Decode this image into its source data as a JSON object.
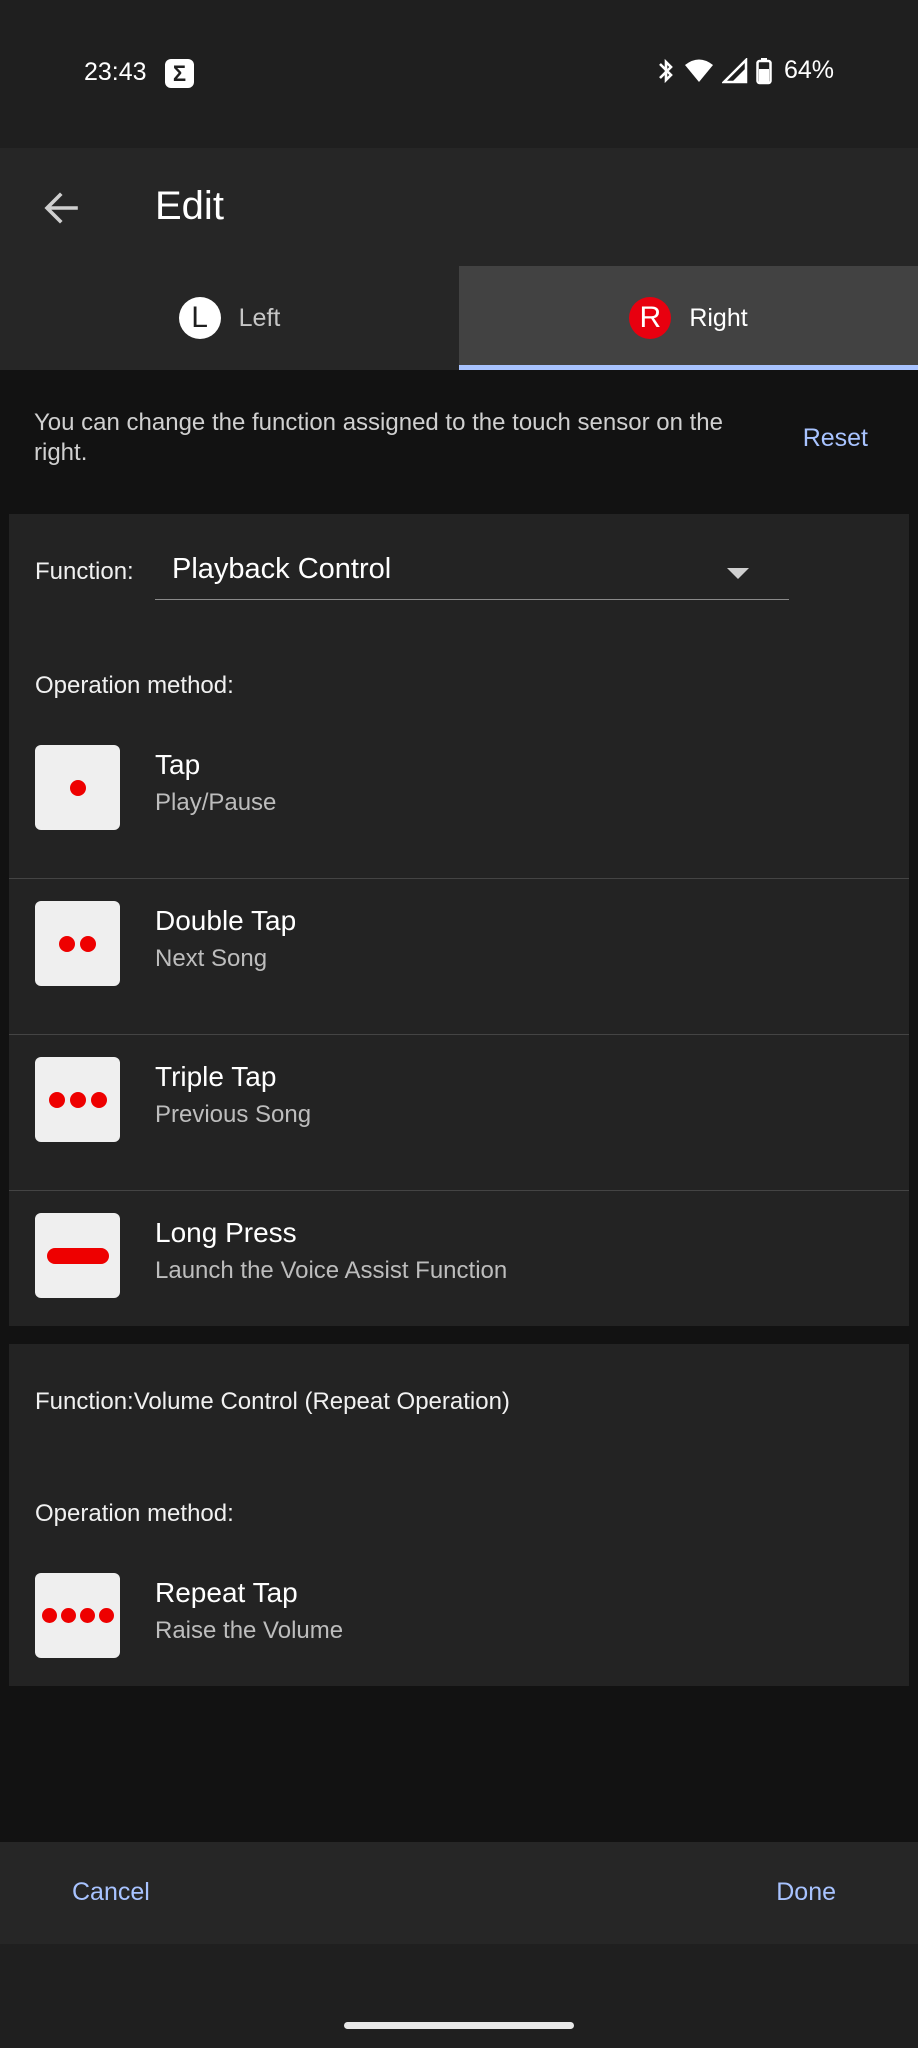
{
  "status_bar": {
    "time": "23:43",
    "battery": "64%"
  },
  "header": {
    "title": "Edit"
  },
  "tabs": [
    {
      "badge": "L",
      "label": "Left",
      "active": false
    },
    {
      "badge": "R",
      "label": "Right",
      "active": true
    }
  ],
  "description": {
    "text": "You can change the function assigned to the touch sensor on the right.",
    "reset_label": "Reset"
  },
  "card1": {
    "function_label": "Function:",
    "function_value": "Playback Control",
    "operation_heading": "Operation method:",
    "operations": [
      {
        "title": "Tap",
        "subtitle": "Play/Pause",
        "icon": "single-dot"
      },
      {
        "title": "Double Tap",
        "subtitle": "Next Song",
        "icon": "double-dot"
      },
      {
        "title": "Triple Tap",
        "subtitle": "Previous Song",
        "icon": "triple-dot"
      },
      {
        "title": "Long Press",
        "subtitle": "Launch the Voice Assist Function",
        "icon": "long-bar"
      }
    ]
  },
  "card2": {
    "function_text": "Function:Volume Control (Repeat Operation)",
    "operation_heading": "Operation method:",
    "operations": [
      {
        "title": "Repeat Tap",
        "subtitle": "Raise the Volume",
        "icon": "quad-dot"
      }
    ]
  },
  "footer": {
    "cancel_label": "Cancel",
    "done_label": "Done"
  },
  "colors": {
    "accent": "#a8c3ff",
    "dot_red": "#ee0000",
    "card_bg": "#232323"
  }
}
